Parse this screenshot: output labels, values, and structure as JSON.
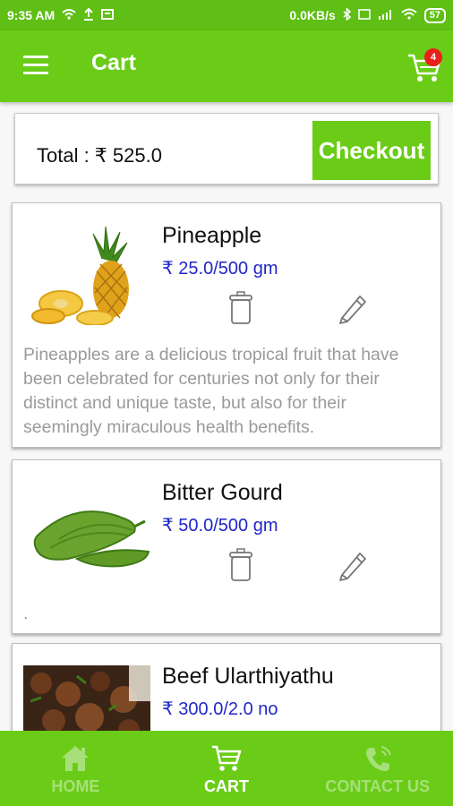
{
  "status_bar": {
    "time": "9:35 AM",
    "network_speed": "0.0KB/s",
    "battery": "57"
  },
  "toolbar": {
    "title": "Cart",
    "cart_count": "4"
  },
  "summary": {
    "total_label": "Total : ₹ 525.0",
    "checkout_label": "Checkout"
  },
  "products": [
    {
      "name": "Pineapple",
      "price": "₹ 25.0/500 gm",
      "description": "Pineapples are a delicious tropical fruit that have been celebrated for centuries not only for their distinct and unique taste, but also for their seemingly miraculous health benefits.",
      "image": "pineapple"
    },
    {
      "name": "Bitter Gourd",
      "price": "₹ 50.0/500 gm",
      "description": ".",
      "image": "bitter-gourd"
    },
    {
      "name": "Beef Ularthiyathu",
      "price": "₹ 300.0/2.0 no",
      "description": "",
      "image": "beef-dish"
    }
  ],
  "bottom_nav": {
    "items": [
      {
        "label": "HOME",
        "icon": "home-icon",
        "active": false
      },
      {
        "label": "CART",
        "icon": "cart-icon",
        "active": true
      },
      {
        "label": "CONTACT US",
        "icon": "phone-icon",
        "active": false
      }
    ]
  },
  "colors": {
    "primary": "#6acc17",
    "status_bar": "#5fbf14",
    "price": "#2027c9",
    "badge": "#e8201c",
    "nav_inactive": "#a7e07a"
  }
}
